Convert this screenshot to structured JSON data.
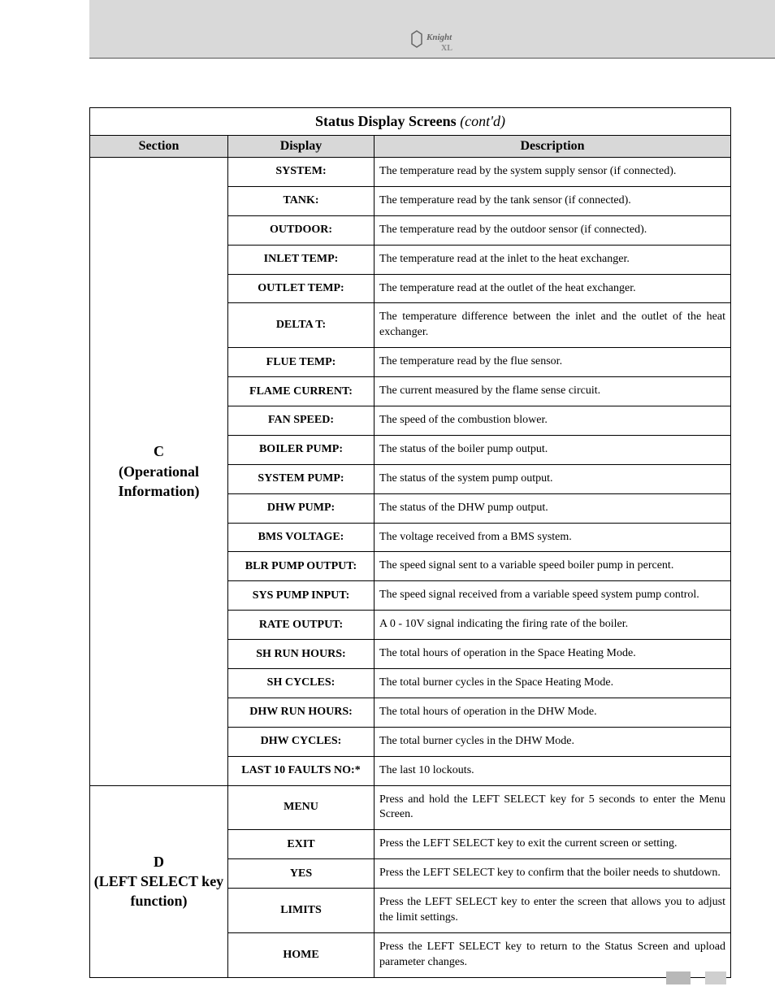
{
  "header": {
    "logoLabel": "Knight XL"
  },
  "table": {
    "title": "Status Display Screens",
    "contd": "(cont'd)",
    "headers": {
      "section": "Section",
      "display": "Display",
      "description": "Description"
    },
    "sections": [
      {
        "label": "C\n(Operational Information)",
        "rows": [
          {
            "display": "SYSTEM:",
            "desc": "The temperature read by the system supply sensor (if connected)."
          },
          {
            "display": "TANK:",
            "desc": "The temperature read by the tank sensor (if connected)."
          },
          {
            "display": "OUTDOOR:",
            "desc": "The temperature read by the outdoor sensor (if connected)."
          },
          {
            "display": "INLET TEMP:",
            "desc": "The temperature read at the inlet to the heat exchanger."
          },
          {
            "display": "OUTLET TEMP:",
            "desc": "The temperature read at the outlet of the heat exchanger."
          },
          {
            "display": "DELTA T:",
            "desc": "The temperature difference between the inlet and the outlet of the heat exchanger."
          },
          {
            "display": "FLUE TEMP:",
            "desc": "The temperature read by the flue sensor."
          },
          {
            "display": "FLAME CURRENT:",
            "desc": "The current measured by the flame sense circuit."
          },
          {
            "display": "FAN SPEED:",
            "desc": "The speed of the combustion blower."
          },
          {
            "display": "BOILER PUMP:",
            "desc": "The status of the boiler pump output."
          },
          {
            "display": "SYSTEM PUMP:",
            "desc": "The status of the system pump output."
          },
          {
            "display": "DHW PUMP:",
            "desc": "The status of the DHW pump output."
          },
          {
            "display": "BMS VOLTAGE:",
            "desc": "The voltage received from a BMS system."
          },
          {
            "display": "BLR PUMP OUTPUT:",
            "desc": "The speed signal sent to a variable speed boiler pump in percent."
          },
          {
            "display": "SYS PUMP INPUT:",
            "desc": "The speed signal received from a variable speed system pump control."
          },
          {
            "display": "RATE OUTPUT:",
            "desc": "A 0 - 10V signal indicating the firing rate of the boiler."
          },
          {
            "display": "SH RUN HOURS:",
            "desc": "The total hours of operation in the Space Heating Mode."
          },
          {
            "display": "SH CYCLES:",
            "desc": "The total burner cycles in the Space Heating Mode."
          },
          {
            "display": "DHW RUN HOURS:",
            "desc": "The total hours of operation in the DHW Mode."
          },
          {
            "display": "DHW CYCLES:",
            "desc": "The total burner cycles in the DHW Mode."
          },
          {
            "display": "LAST 10 FAULTS NO:*",
            "desc": "The last 10 lockouts."
          }
        ]
      },
      {
        "label": "D\n(LEFT SELECT key function)",
        "rows": [
          {
            "display": "MENU",
            "desc": "Press and hold the LEFT SELECT key for 5 seconds to enter the Menu Screen."
          },
          {
            "display": "EXIT",
            "desc": "Press the LEFT SELECT key to exit the current screen or setting."
          },
          {
            "display": "YES",
            "desc": "Press the LEFT SELECT key to confirm that the boiler needs to shutdown."
          },
          {
            "display": "LIMITS",
            "desc": "Press the LEFT SELECT key to enter the screen that allows you to adjust the limit settings."
          },
          {
            "display": "HOME",
            "desc": "Press the LEFT SELECT key to return to the Status Screen and upload parameter changes."
          }
        ]
      }
    ]
  }
}
